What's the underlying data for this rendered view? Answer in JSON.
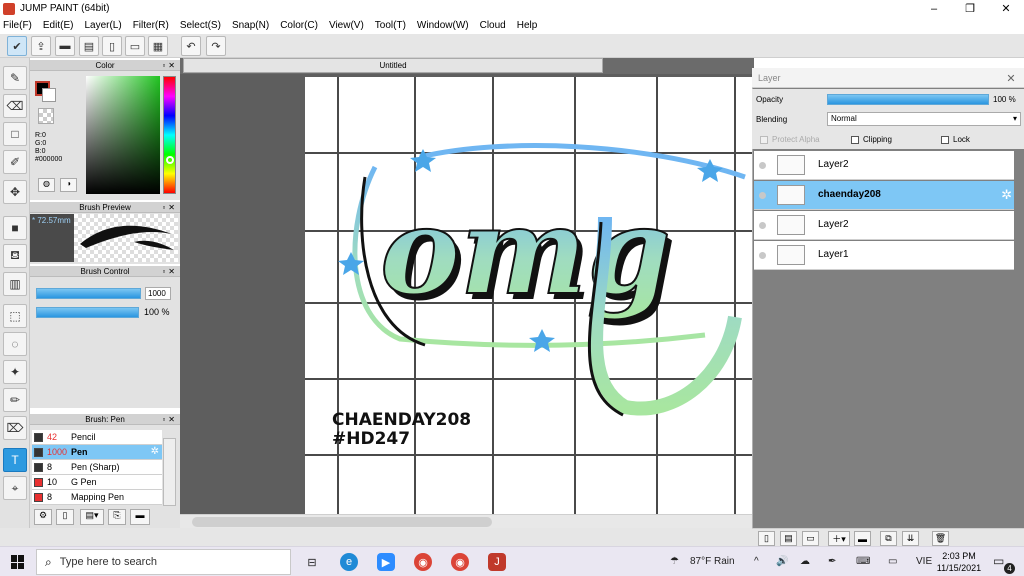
{
  "window": {
    "title": "JUMP PAINT (64bit)",
    "minimize": "–",
    "maximize": "❐",
    "close": "✕"
  },
  "menu": [
    "File(F)",
    "Edit(E)",
    "Layer(L)",
    "Filter(R)",
    "Select(S)",
    "Snap(N)",
    "Color(C)",
    "View(V)",
    "Tool(T)",
    "Window(W)",
    "Cloud",
    "Help"
  ],
  "canvas": {
    "tab_title": "Untitled",
    "signature_line1": "CHAENDAY208",
    "signature_line2": "#HD247",
    "artwork_text": "omg"
  },
  "color_panel": {
    "title": "Color",
    "r": "R:0",
    "g": "G:0",
    "b": "B:0",
    "hex": "#000000"
  },
  "brush_preview": {
    "title": "Brush Preview",
    "size_label": "* 72.57mm"
  },
  "brush_control": {
    "title": "Brush Control",
    "size_value": "1000",
    "opacity_value": "100 %"
  },
  "brush_list": {
    "title": "Brush: Pen",
    "items": [
      {
        "size": "42",
        "name": "Pencil",
        "color": "#333333"
      },
      {
        "size": "1000",
        "name": "Pen",
        "color": "#333333"
      },
      {
        "size": "8",
        "name": "Pen (Sharp)",
        "color": "#333333"
      },
      {
        "size": "10",
        "name": "G Pen",
        "color": "#e83030"
      },
      {
        "size": "8",
        "name": "Mapping Pen",
        "color": "#e83030"
      }
    ]
  },
  "layer_panel": {
    "title": "Layer",
    "opacity_label": "Opacity",
    "opacity_value": "100 %",
    "blending_label": "Blending",
    "blending_value": "Normal",
    "protect_alpha": "Protect Alpha",
    "clipping": "Clipping",
    "lock": "Lock",
    "layers": [
      {
        "name": "Layer2"
      },
      {
        "name": "chaenday208"
      },
      {
        "name": "Layer2"
      },
      {
        "name": "Layer1"
      }
    ]
  },
  "taskbar": {
    "search_placeholder": "Type here to search",
    "weather": "87°F Rain",
    "lang": "VIE",
    "time": "2:03 PM",
    "date": "11/15/2021",
    "notifications": "4"
  },
  "colors": {
    "accent": "#2d9ae0",
    "selection": "#7ec7f5",
    "canvas_bg": "#5e5e5e"
  }
}
